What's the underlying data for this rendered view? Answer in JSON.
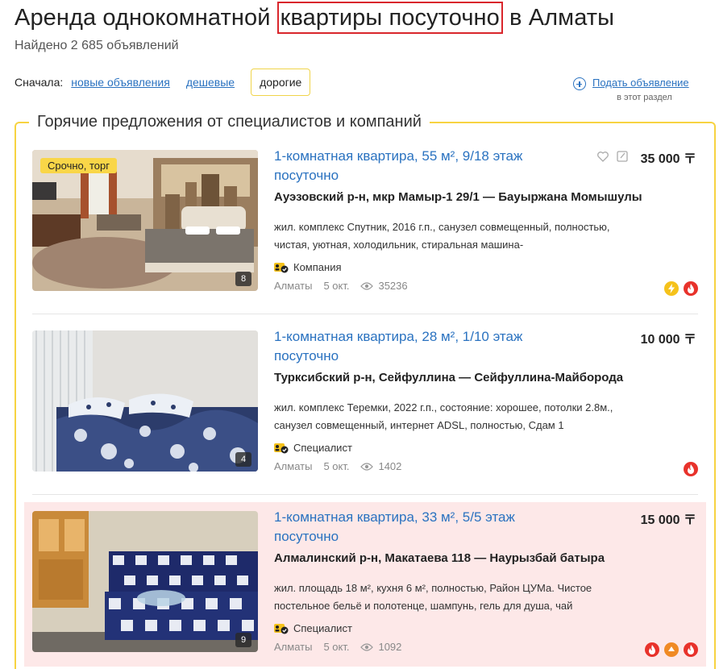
{
  "header": {
    "title_before": "Аренда однокомнатной ",
    "title_highlight": "квартиры посуточно",
    "title_after": " в Алматы",
    "count": "Найдено 2 685 объявлений"
  },
  "sort": {
    "label": "Сначала:",
    "options": [
      "новые объявления",
      "дешевые",
      "дорогие"
    ],
    "active": "дорогие"
  },
  "post_ad": {
    "label": "Подать объявление",
    "sub": "в этот раздел"
  },
  "hot_section": {
    "title": "Горячие предложения от специалистов и компаний"
  },
  "listings": [
    {
      "badge": "Срочно, торг",
      "photo_count": "8",
      "title": "1-комнатная квартира, 55 м², 9/18 этаж посуточно",
      "address": "Ауэзовский р-н, мкр Мамыр-1 29/1 — Бауыржана Момышулы",
      "desc": "жил. комплекс Спутник, 2016 г.п., санузел совмещенный, полностью, чистая, уютная, холодильник, стиральная машина-",
      "owner": "Компания",
      "city": "Алматы",
      "date": "5 окт.",
      "views": "35236",
      "price": "35 000 〒"
    },
    {
      "badge": "",
      "photo_count": "4",
      "title": "1-комнатная квартира, 28 м², 1/10 этаж посуточно",
      "address": "Турксибский р-н, Сейфуллина — Сейфуллина-Майборода",
      "desc": "жил. комплекс Теремки, 2022 г.п., состояние: хорошее, потолки 2.8м., санузел совмещенный, интернет ADSL, полностью, Сдам 1",
      "owner": "Специалист",
      "city": "Алматы",
      "date": "5 окт.",
      "views": "1402",
      "price": "10 000 〒"
    },
    {
      "badge": "",
      "photo_count": "9",
      "title": "1-комнатная квартира, 33 м², 5/5 этаж посуточно",
      "address": "Алмалинский р-н, Макатаева 118 — Наурызбай батыра",
      "desc": "жил. площадь 18 м², кухня 6 м², полностью, Район ЦУМа. Чистое постельное бельё и полотенце, шампунь, гель для душа, чай",
      "owner": "Специалист",
      "city": "Алматы",
      "date": "5 окт.",
      "views": "1092",
      "price": "15 000 〒"
    }
  ],
  "colors": {
    "link": "#2a72c0",
    "highlight_border": "#d9262c",
    "hot_border": "#f7d341",
    "highlight_bg": "#fde8e8",
    "promo_red": "#e8322b",
    "promo_yellow": "#f5c21b",
    "promo_orange": "#f08a24"
  },
  "icons": {
    "owner": "verified-badge-icon",
    "views": "eye-icon",
    "favorite": "heart-icon",
    "note": "note-icon",
    "hot": "flame-icon",
    "top": "lightning-icon",
    "up": "arrow-up-icon"
  }
}
